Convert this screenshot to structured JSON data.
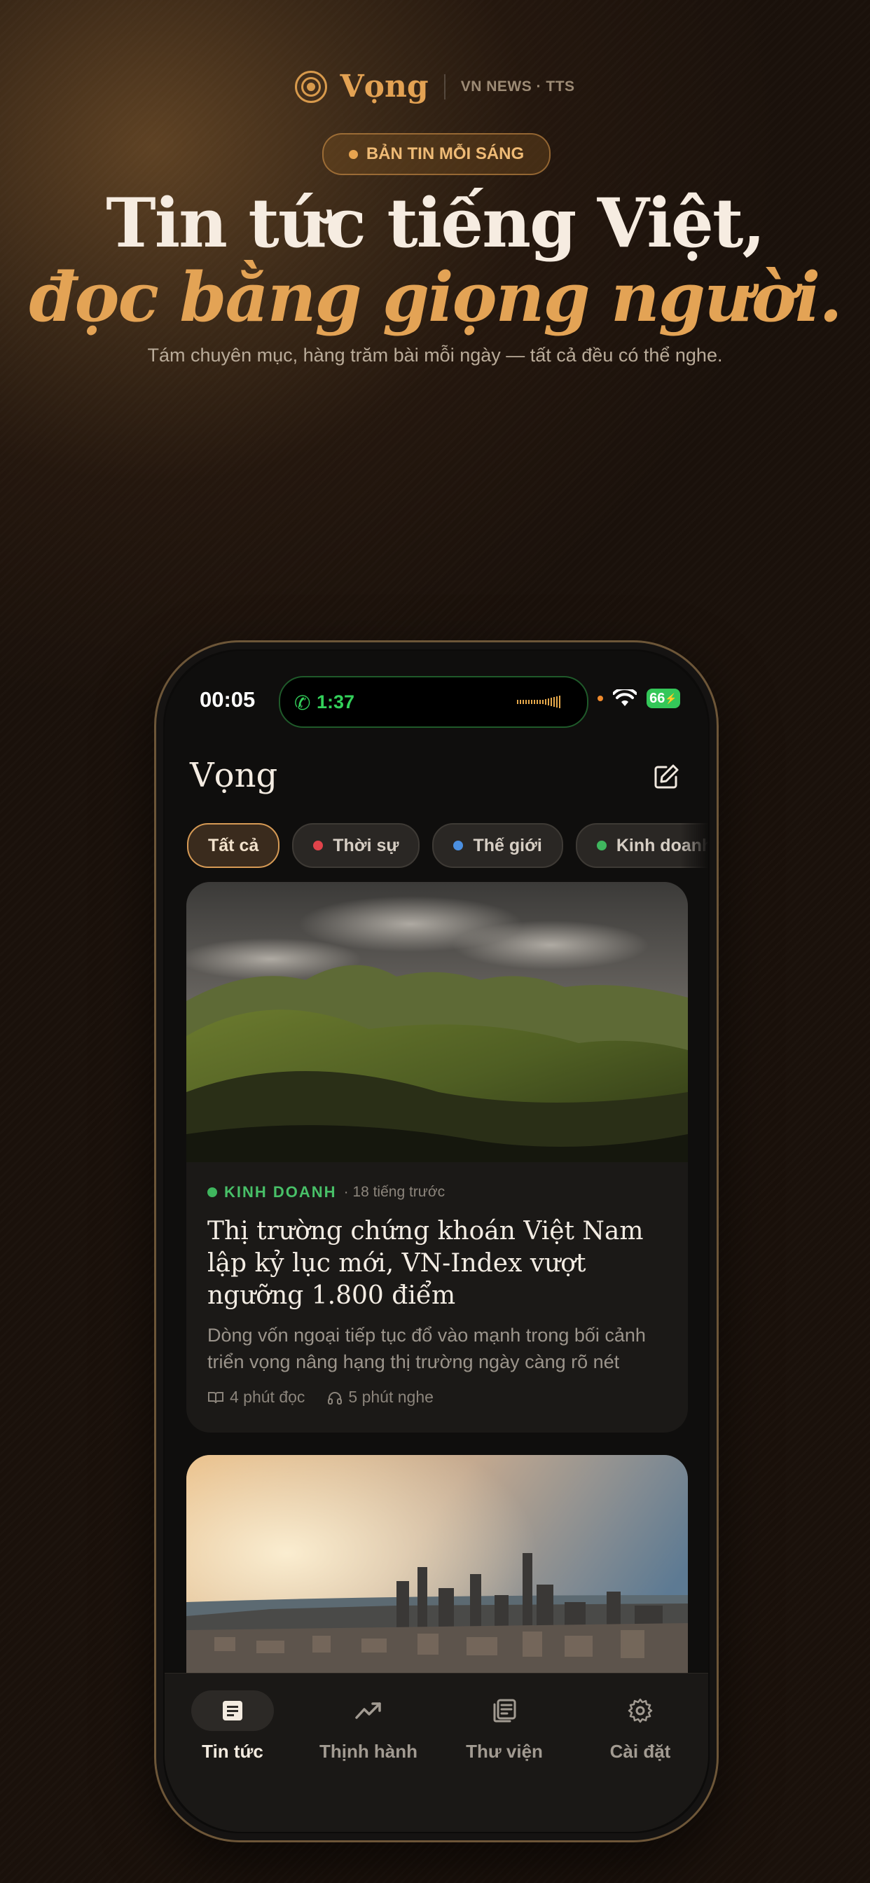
{
  "brand": {
    "name": "Vọng",
    "tagline": "VN NEWS · TTS"
  },
  "hero": {
    "badge": "BẢN TIN MỖI SÁNG",
    "headline_line1": "Tin tức tiếng Việt,",
    "headline_line2": "đọc bằng giọng người.",
    "subtitle": "Tám chuyên mục, hàng trăm bài mỗi ngày — tất cả đều có thể nghe."
  },
  "status_bar": {
    "time": "00:05",
    "call_time": "1:37",
    "battery": "66"
  },
  "app": {
    "title": "Vọng"
  },
  "categories": [
    {
      "label": "Tất cả",
      "active": true,
      "color": ""
    },
    {
      "label": "Thời sự",
      "active": false,
      "color": "#e0434a"
    },
    {
      "label": "Thế giới",
      "active": false,
      "color": "#4b8fe0"
    },
    {
      "label": "Kinh doanh",
      "active": false,
      "color": "#3fb65e"
    }
  ],
  "articles": [
    {
      "category": "KINH DOANH",
      "time": "· 18 tiếng trước",
      "headline": "Thị trường chứng khoán Việt Nam lập kỷ lục mới, VN-Index vượt ngưỡng 1.800 điểm",
      "excerpt": "Dòng vốn ngoại tiếp tục đổ vào mạnh trong bối cảnh triển vọng nâng hạng thị trường ngày càng rõ nét",
      "read": "4 phút đọc",
      "listen": "5 phút nghe"
    }
  ],
  "tabs": [
    {
      "label": "Tin tức",
      "icon": "article-icon",
      "active": true
    },
    {
      "label": "Thịnh hành",
      "icon": "trending-icon",
      "active": false
    },
    {
      "label": "Thư viện",
      "icon": "library-icon",
      "active": false
    },
    {
      "label": "Cài đặt",
      "icon": "gear-icon",
      "active": false
    }
  ],
  "colors": {
    "accent": "#e3a253",
    "background": "#1a110b",
    "category_business": "#3fb65e"
  }
}
